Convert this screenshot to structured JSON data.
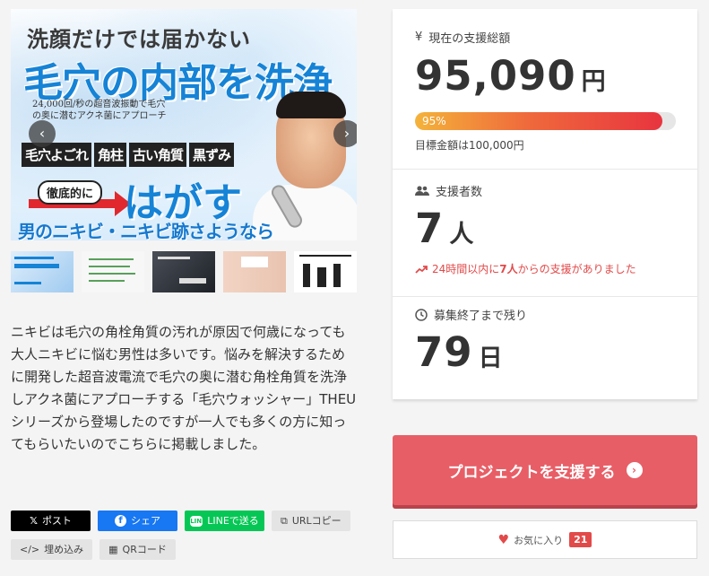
{
  "hero": {
    "line1": "洗顔だけでは届かない",
    "line2": "毛穴の内部を洗浄",
    "sub": "24,000回/秒の超音波振動で毛穴の奥に潜むアクネ菌にアプローチ",
    "tags": [
      "毛穴よごれ",
      "角柱",
      "古い角質",
      "黒ずみ"
    ],
    "thorough": "徹底的に",
    "peel": "はがす",
    "bottom": "男のニキビ・ニキビ跡さようなら",
    "prev_icon": "‹",
    "next_icon": "›"
  },
  "thumbnails": [
    "thumb-1",
    "thumb-2",
    "thumb-3",
    "thumb-4",
    "thumb-5"
  ],
  "description": "ニキビは毛穴の角栓角質の汚れが原因で何歳になっても大人ニキビに悩む男性は多いです。悩みを解決するために開発した超音波電流で毛穴の奥に潜む角栓角質を洗浄しアクネ菌にアプローチする「毛穴ウォッシャー」THEUシリーズから登場したのですが一人でも多くの方に知ってもらいたいのでこちらに掲載しました。",
  "share": {
    "x_label": "ポスト",
    "x_icon": "𝕏",
    "facebook_label": "シェア",
    "facebook_icon": "f",
    "line_label": "LINEで送る",
    "line_icon": "LINE",
    "url_label": "URLコピー",
    "url_icon": "⧉",
    "embed_label": "埋め込み",
    "embed_icon": "</>",
    "qr_label": "QRコード",
    "qr_icon": "▦"
  },
  "stats": {
    "total_icon": "¥",
    "total_label": "現在の支援総額",
    "total_value": "95,090",
    "total_unit": "円",
    "progress_percent": 95,
    "progress_label": "95%",
    "goal_text": "目標金額は100,000円",
    "supporters_label": "支援者数",
    "supporters_value": "7",
    "supporters_unit": "人",
    "recent_prefix": "24時間以内に",
    "recent_count": "7人",
    "recent_suffix": "からの支援がありました",
    "remaining_label": "募集終了まで残り",
    "remaining_value": "79",
    "remaining_unit": "日"
  },
  "support_button": {
    "label": "プロジェクトを支援する",
    "icon": "›"
  },
  "favorite": {
    "label": "お気に入り",
    "count": "21",
    "icon": "♥"
  },
  "colors": {
    "accent": "#e85e66",
    "progress_start": "#f4b33a",
    "progress_end": "#e8343f",
    "recent_text": "#e24a4a"
  }
}
